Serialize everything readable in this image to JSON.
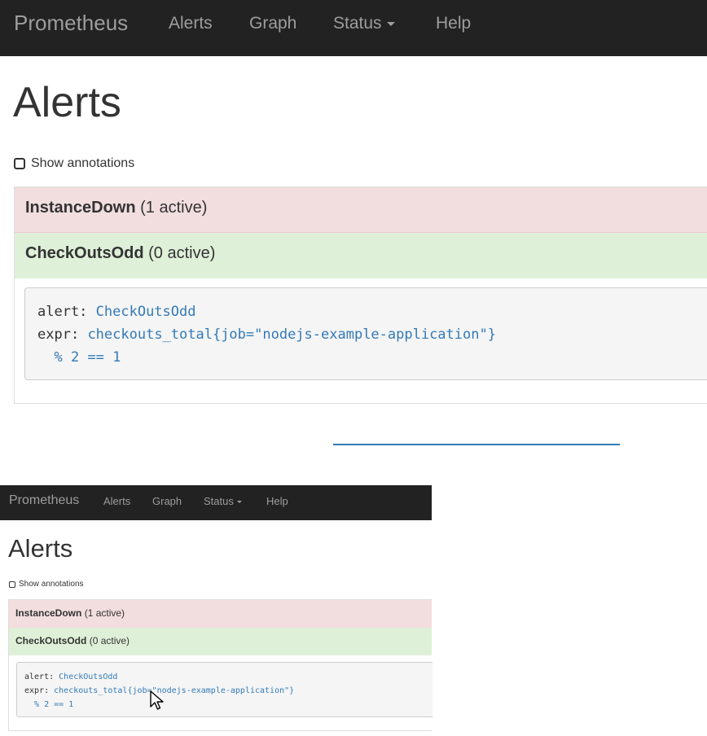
{
  "nav": {
    "brand": "Prometheus",
    "items": [
      "Alerts",
      "Graph",
      "Status",
      "Help"
    ]
  },
  "page_title": "Alerts",
  "show_annotations_label": "Show annotations",
  "groups": [
    {
      "name": "InstanceDown",
      "count": "(1 active)",
      "state": "firing",
      "color": "#f2dede"
    },
    {
      "name": "CheckOutsOdd",
      "count": "(0 active)",
      "state": "inactive",
      "color": "#dff0d8"
    }
  ],
  "rule": {
    "alert_key": "alert:",
    "alert_value": "CheckOutsOdd",
    "expr_key": "expr:",
    "expr_value": "checkouts_total{job=\"nodejs-example-application\"}",
    "expr_cont": "% 2 == 1"
  },
  "colors": {
    "navbar": "#222222",
    "link": "#337ab7"
  },
  "icons": {
    "cursor": "mouse-pointer-icon",
    "caret": "caret-down-icon",
    "checkbox": "checkbox-icon"
  }
}
